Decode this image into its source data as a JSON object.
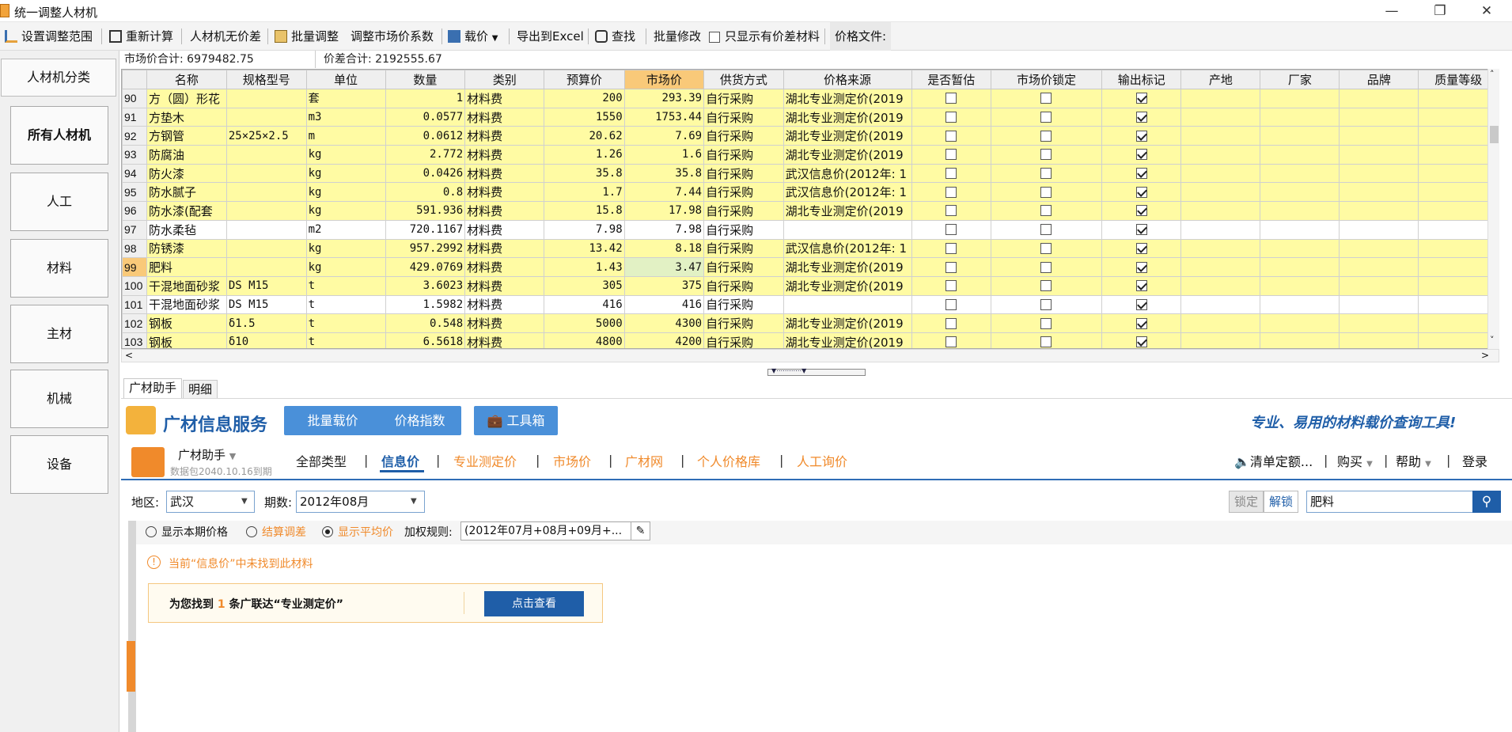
{
  "window": {
    "title": "统一调整人材机"
  },
  "toolbar": {
    "set_range": "设置调整范围",
    "recalc": "重新计算",
    "no_diff": "人材机无价差",
    "batch_adjust": "批量调整",
    "adjust_coef": "调整市场价系数",
    "load_price": "载价",
    "export_excel": "导出到Excel",
    "find": "查找",
    "batch_modify": "批量修改",
    "show_diff_only": "只显示有价差材料",
    "price_file": "价格文件:"
  },
  "sidebar": {
    "items": [
      {
        "label": "人材机分类"
      },
      {
        "label": "所有人材机"
      },
      {
        "label": "人工"
      },
      {
        "label": "材料"
      },
      {
        "label": "主材"
      },
      {
        "label": "机械"
      },
      {
        "label": "设备"
      }
    ]
  },
  "summary": {
    "market_total_label": "市场价合计:",
    "market_total": "6979482.75",
    "diff_total_label": "价差合计:",
    "diff_total": "2192555.67"
  },
  "grid": {
    "columns": [
      "名称",
      "规格型号",
      "单位",
      "数量",
      "类别",
      "预算价",
      "市场价",
      "供货方式",
      "价格来源",
      "是否暂估",
      "市场价锁定",
      "输出标记",
      "产地",
      "厂家",
      "品牌",
      "质量等级"
    ],
    "rows": [
      {
        "no": "90",
        "name": "方（圆）形花",
        "spec": "",
        "unit": "套",
        "qty": "1",
        "cat": "材料费",
        "budget": "200",
        "market": "293.39",
        "supply": "自行采购",
        "source": "湖北专业测定价(2019",
        "est": false,
        "lock": false,
        "out": true
      },
      {
        "no": "91",
        "name": "方垫木",
        "spec": "",
        "unit": "m3",
        "qty": "0.0577",
        "cat": "材料费",
        "budget": "1550",
        "market": "1753.44",
        "supply": "自行采购",
        "source": "湖北专业测定价(2019",
        "est": false,
        "lock": false,
        "out": true
      },
      {
        "no": "92",
        "name": "方钢管",
        "spec": "25×25×2.5",
        "unit": "m",
        "qty": "0.0612",
        "cat": "材料费",
        "budget": "20.62",
        "market": "7.69",
        "supply": "自行采购",
        "source": "湖北专业测定价(2019",
        "est": false,
        "lock": false,
        "out": true
      },
      {
        "no": "93",
        "name": "防腐油",
        "spec": "",
        "unit": "kg",
        "qty": "2.772",
        "cat": "材料费",
        "budget": "1.26",
        "market": "1.6",
        "supply": "自行采购",
        "source": "湖北专业测定价(2019",
        "est": false,
        "lock": false,
        "out": true
      },
      {
        "no": "94",
        "name": "防火漆",
        "spec": "",
        "unit": "kg",
        "qty": "0.0426",
        "cat": "材料费",
        "budget": "35.8",
        "market": "35.8",
        "supply": "自行采购",
        "source": "武汉信息价(2012年: 1",
        "est": false,
        "lock": false,
        "out": true
      },
      {
        "no": "95",
        "name": "防水腻子",
        "spec": "",
        "unit": "kg",
        "qty": "0.8",
        "cat": "材料费",
        "budget": "1.7",
        "market": "7.44",
        "supply": "自行采购",
        "source": "武汉信息价(2012年: 1",
        "est": false,
        "lock": false,
        "out": true
      },
      {
        "no": "96",
        "name": "防水漆(配套",
        "spec": "",
        "unit": "kg",
        "qty": "591.936",
        "cat": "材料费",
        "budget": "15.8",
        "market": "17.98",
        "supply": "自行采购",
        "source": "湖北专业测定价(2019",
        "est": false,
        "lock": false,
        "out": true
      },
      {
        "no": "97",
        "name": "防水柔毡",
        "spec": "",
        "unit": "m2",
        "qty": "720.1167",
        "cat": "材料费",
        "budget": "7.98",
        "market": "7.98",
        "supply": "自行采购",
        "source": "",
        "est": false,
        "lock": false,
        "out": true
      },
      {
        "no": "98",
        "name": "防锈漆",
        "spec": "",
        "unit": "kg",
        "qty": "957.2992",
        "cat": "材料费",
        "budget": "13.42",
        "market": "8.18",
        "supply": "自行采购",
        "source": "武汉信息价(2012年: 1",
        "est": false,
        "lock": false,
        "out": true
      },
      {
        "no": "99",
        "name": "肥料",
        "spec": "",
        "unit": "kg",
        "qty": "429.0769",
        "cat": "材料费",
        "budget": "1.43",
        "market": "3.47",
        "supply": "自行采购",
        "source": "湖北专业测定价(2019",
        "est": false,
        "lock": false,
        "out": true
      },
      {
        "no": "100",
        "name": "干混地面砂浆",
        "spec": "DS M15",
        "unit": "t",
        "qty": "3.6023",
        "cat": "材料费",
        "budget": "305",
        "market": "375",
        "supply": "自行采购",
        "source": "湖北专业测定价(2019",
        "est": false,
        "lock": false,
        "out": true
      },
      {
        "no": "101",
        "name": "干混地面砂浆",
        "spec": "DS M15",
        "unit": "t",
        "qty": "1.5982",
        "cat": "材料费",
        "budget": "416",
        "market": "416",
        "supply": "自行采购",
        "source": "",
        "est": false,
        "lock": false,
        "out": true
      },
      {
        "no": "102",
        "name": "钢板",
        "spec": "δ1.5",
        "unit": "t",
        "qty": "0.548",
        "cat": "材料费",
        "budget": "5000",
        "market": "4300",
        "supply": "自行采购",
        "source": "湖北专业测定价(2019",
        "est": false,
        "lock": false,
        "out": true
      },
      {
        "no": "103",
        "name": "钢板",
        "spec": "δ10",
        "unit": "t",
        "qty": "6.5618",
        "cat": "材料费",
        "budget": "4800",
        "market": "4200",
        "supply": "自行采购",
        "source": "湖北专业测定价(2019",
        "est": false,
        "lock": false,
        "out": true
      }
    ]
  },
  "tabs": [
    "广材助手",
    "明细"
  ],
  "gc": {
    "brand": "广材信息服务",
    "batch_load": "批量载价",
    "price_index": "价格指数",
    "toolbox": "工具箱",
    "slogan": "专业、易用的材料载价查询工具!",
    "assistant": "广材助手",
    "package": "数据包2040.10.16到期",
    "nav": [
      "全部类型",
      "信息价",
      "专业测定价",
      "市场价",
      "广材网",
      "个人价格库",
      "人工询价"
    ],
    "right_links": [
      "清单定额...",
      "购买",
      "帮助",
      "登录"
    ],
    "region_label": "地区:",
    "region": "武汉",
    "period_label": "期数:",
    "period": "2012年08月",
    "lock": "锁定",
    "unlock": "解锁",
    "search_value": "肥料",
    "opt_current": "显示本期价格",
    "opt_settle": "结算调差",
    "opt_avg": "显示平均价",
    "weight_label": "加权规则:",
    "weight_value": "(2012年07月+08月+09月+...",
    "notice": "当前“信息价”中未找到此材料",
    "found_prefix": "为您找到",
    "found_count": "1",
    "found_suffix": "条广联达“专业测定价”",
    "view_btn": "点击查看"
  }
}
